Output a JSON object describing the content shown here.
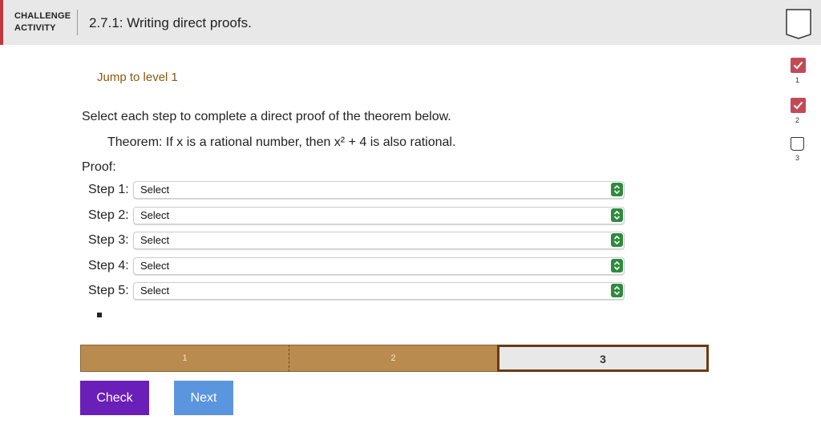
{
  "header": {
    "kind_line1": "CHALLENGE",
    "kind_line2": "ACTIVITY",
    "title": "2.7.1: Writing direct proofs."
  },
  "levels": [
    {
      "number": "1",
      "status": "completed"
    },
    {
      "number": "2",
      "status": "completed"
    },
    {
      "number": "3",
      "status": "not-started"
    }
  ],
  "jump_link": "Jump to level 1",
  "instructions": "Select each step to complete a direct proof of the theorem below.",
  "theorem": "Theorem: If x is a rational number, then x² + 4 is also rational.",
  "proof_label": "Proof:",
  "steps": [
    {
      "label": "Step 1:",
      "value": "Select"
    },
    {
      "label": "Step 2:",
      "value": "Select"
    },
    {
      "label": "Step 3:",
      "value": "Select"
    },
    {
      "label": "Step 4:",
      "value": "Select"
    },
    {
      "label": "Step 5:",
      "value": "Select"
    }
  ],
  "progress": [
    {
      "label": "1",
      "state": "completed"
    },
    {
      "label": "2",
      "state": "completed"
    },
    {
      "label": "3",
      "state": "current"
    }
  ],
  "buttons": {
    "check": "Check",
    "next": "Next"
  },
  "colors": {
    "header_accent": "#c4373f",
    "level_done": "#c34a55",
    "jump_link": "#8a5a10",
    "select_arrow": "#2e8b3e",
    "progress_done": "#b98b4e",
    "progress_current_border": "#6b3a15",
    "check_button": "#6a1fb8",
    "next_button": "#5b95de"
  }
}
